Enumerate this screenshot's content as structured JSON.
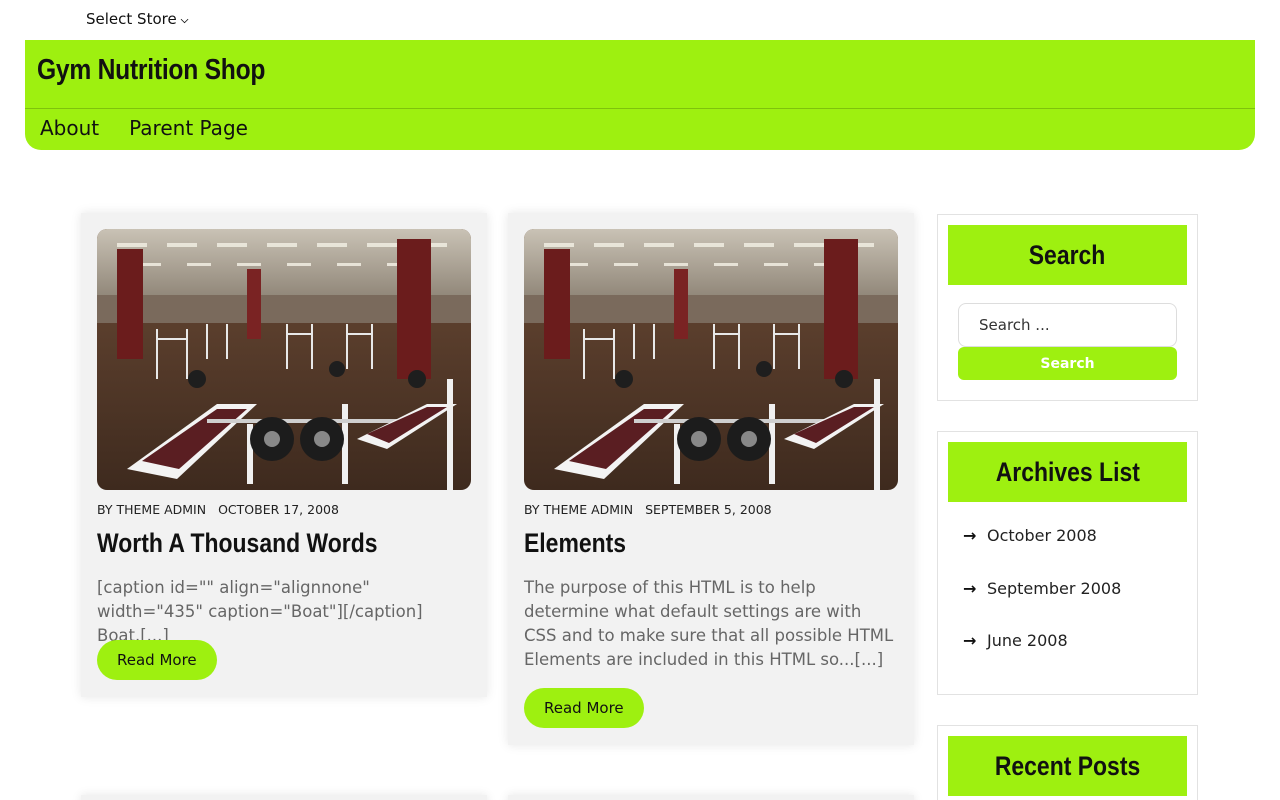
{
  "topbar": {
    "store_label": "Select Store",
    "chevron_icon": "chevron-down-icon"
  },
  "header": {
    "site_title": "Gym Nutrition Shop",
    "nav": [
      "About",
      "Parent Page"
    ],
    "accent_color": "#9ef010"
  },
  "posts": [
    {
      "image": "gym-interior-photo",
      "author": "BY THEME ADMIN",
      "date": "OCTOBER 17, 2008",
      "title": "Worth A Thousand Words",
      "excerpt": "[caption id=\"\" align=\"alignnone\" width=\"435\" caption=\"Boat\"][/caption] Boat.[...]",
      "read_more": "Read More"
    },
    {
      "image": "gym-interior-photo",
      "author": "BY THEME ADMIN",
      "date": "SEPTEMBER 5, 2008",
      "title": "Elements",
      "excerpt": "The purpose of this HTML is to help determine what default settings are with CSS and to make sure that all possible HTML Elements are included in this HTML so...[...]",
      "read_more": "Read More"
    }
  ],
  "sidebar": {
    "search": {
      "title": "Search",
      "placeholder": "Search ...",
      "button": "Search"
    },
    "archives": {
      "title": "Archives List",
      "items": [
        "October 2008",
        "September 2008",
        "June 2008"
      ],
      "item_icon": "arrow-right-icon"
    },
    "recent_posts": {
      "title": "Recent Posts"
    }
  }
}
